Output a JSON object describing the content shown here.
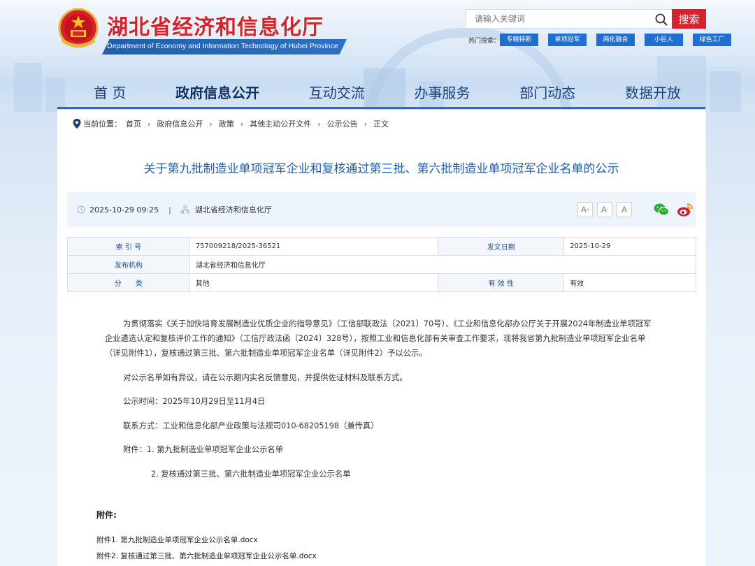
{
  "site": {
    "title": "湖北省经济和信息化厅",
    "subtitle": "Department of Economy and Information Technology of Hubei Province"
  },
  "search": {
    "placeholder": "请输入关键词",
    "button_label": "搜索",
    "hot_label": "热门搜索：",
    "hot_tags": [
      "专精特新",
      "单项冠军",
      "两化融合",
      "小巨人",
      "绿色工厂"
    ]
  },
  "nav": {
    "items": [
      "首 页",
      "政府信息公开",
      "互动交流",
      "办事服务",
      "部门动态",
      "数据开放"
    ],
    "active_index": 1
  },
  "breadcrumb": {
    "prefix": "当前位置：",
    "items": [
      "首页",
      "政府信息公开",
      "政策",
      "其他主动公开文件",
      "公示公告",
      "正文"
    ]
  },
  "article": {
    "title": "关于第九批制造业单项冠军企业和复核通过第三批、第六批制造业单项冠军企业名单的公示",
    "datetime": "2025-10-29 09:25",
    "divider": "|",
    "source": "湖北省经济和信息化厅",
    "font_buttons": [
      "A",
      "A",
      "A"
    ]
  },
  "info": {
    "index_label": "索 引 号",
    "index_value": "757009218/2025-36521",
    "date_label": "发文日期",
    "date_value": "2025-10-29",
    "publisher_label": "发布机构",
    "publisher_value": "湖北省经济和信息化厅",
    "category_label": "分　　类",
    "category_value": "其他",
    "validity_label": "有 效 性",
    "validity_value": "有效"
  },
  "body": {
    "p1": "为贯彻落实《关于加快培育发展制造业优质企业的指导意见》（工信部联政法〔2021〕70号）、《工业和信息化部办公厅关于开展2024年制造业单项冠军企业遴选认定和复核评价工作的通知》（工信厅政法函〔2024〕328号），按照工业和信息化部有关审查工作要求，现将我省第九批制造业单项冠军企业名单（详见附件1），复核通过第三批、第六批制造业单项冠军企业名单（详见附件2）予以公示。",
    "p2": "对公示名单如有异议，请在公示期内实名反馈意见，并提供佐证材料及联系方式。",
    "p3": "公示时间：2025年10月29日至11月4日",
    "p4": "联系方式：工业和信息化部产业政策与法规司010-68205198（兼传真）",
    "p5": "附件：1. 第九批制造业单项冠军企业公示名单",
    "p6": "2. 复核通过第三批、第六批制造业单项冠军企业公示名单"
  },
  "attachments": {
    "heading": "附件:",
    "files": [
      "附件1. 第九批制造业单项冠军企业公示名单.docx",
      "附件2. 复核通过第三批、第六批制造业单项冠军企业公示名单.docx"
    ]
  },
  "colors": {
    "brand_red": "#d8212a",
    "brand_blue": "#1e6fd0",
    "title_blue": "#1e5db8"
  },
  "icons": [
    "national-emblem-icon",
    "search-icon",
    "location-pin-icon",
    "clock-icon",
    "organization-icon",
    "wechat-icon",
    "weibo-icon"
  ]
}
